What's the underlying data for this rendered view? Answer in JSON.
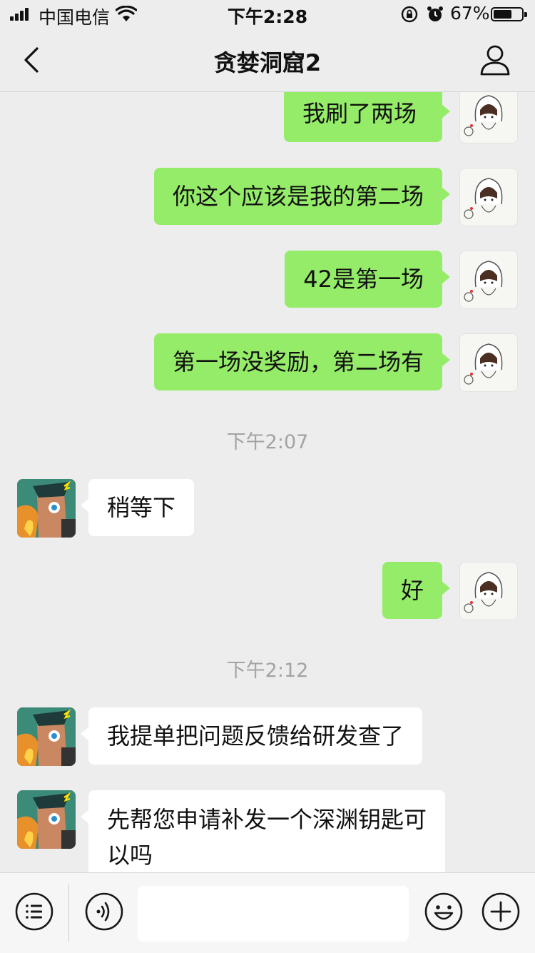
{
  "status_bar": {
    "carrier": "中国电信",
    "time": "下午2:28",
    "battery_percent": "67%",
    "battery_level": 0.67
  },
  "nav": {
    "title": "贪婪洞窟2"
  },
  "messages": [
    {
      "side": "me",
      "text": "我刷了两场"
    },
    {
      "side": "me",
      "text": "你这个应该是我的第二场"
    },
    {
      "side": "me",
      "text": "42是第一场"
    },
    {
      "side": "me",
      "text": "第一场没奖励，第二场有"
    },
    {
      "type": "time",
      "text": "下午2:07"
    },
    {
      "side": "other",
      "text": "稍等下"
    },
    {
      "side": "me",
      "text": "好"
    },
    {
      "type": "time",
      "text": "下午2:12"
    },
    {
      "side": "other",
      "text": "我提单把问题反馈给研发查了"
    },
    {
      "side": "other",
      "text": "先帮您申请补发一个深渊钥匙可以吗"
    }
  ],
  "input": {
    "value": "",
    "placeholder": ""
  },
  "icons": {
    "back": "chevron-left-icon",
    "profile": "person-icon",
    "menu": "list-menu-icon",
    "voice": "voice-icon",
    "emoji": "smiley-icon",
    "more": "plus-icon"
  },
  "colors": {
    "my_bubble": "#95ec69",
    "other_bubble": "#ffffff",
    "background": "#ededed"
  }
}
